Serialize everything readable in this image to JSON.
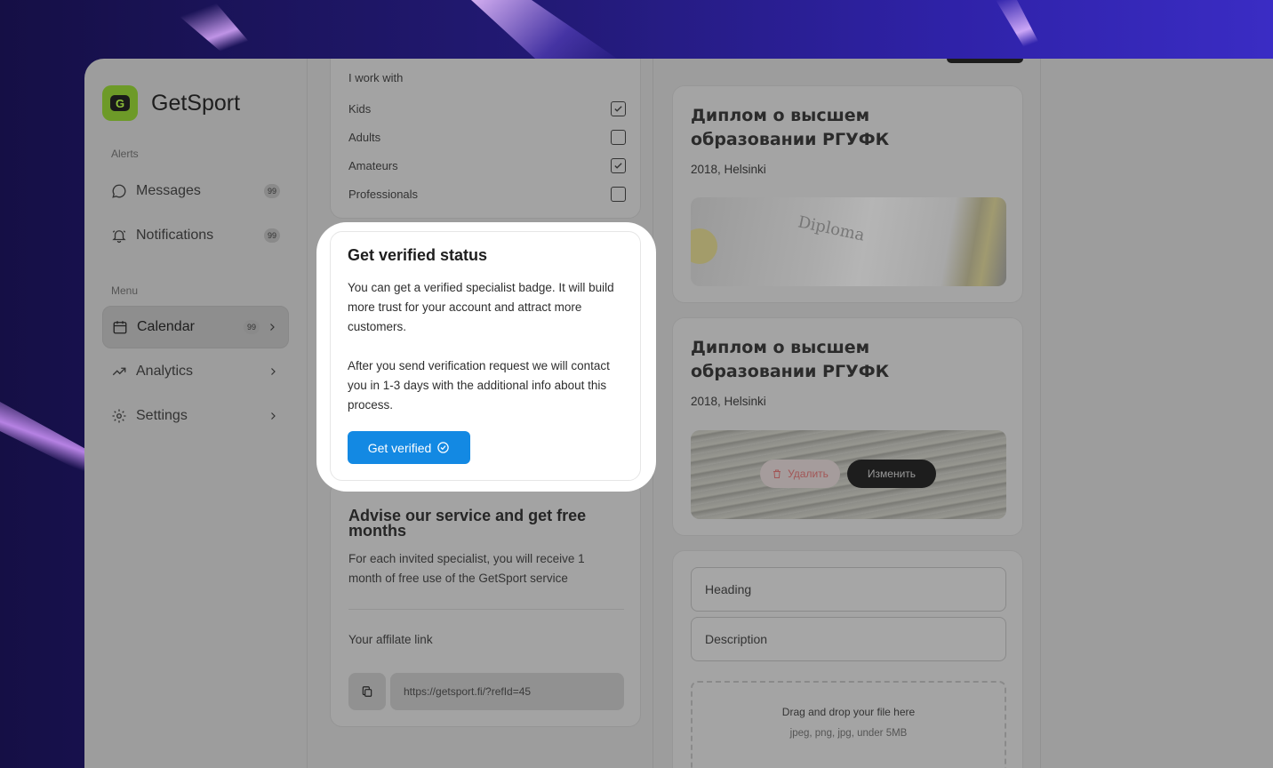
{
  "brand": {
    "name": "GetSport",
    "logo_letter": "G"
  },
  "sidebar": {
    "alerts_label": "Alerts",
    "menu_label": "Menu",
    "alerts": [
      {
        "label": "Messages",
        "badge": "99"
      },
      {
        "label": "Notifications",
        "badge": "99"
      }
    ],
    "menu": [
      {
        "label": "Calendar",
        "badge": "99",
        "active": true
      },
      {
        "label": "Analytics"
      },
      {
        "label": "Settings"
      }
    ]
  },
  "work_with": {
    "title": "I work with",
    "options": [
      {
        "label": "Kids",
        "checked": true
      },
      {
        "label": "Adults",
        "checked": false
      },
      {
        "label": "Amateurs",
        "checked": true
      },
      {
        "label": "Professionals",
        "checked": false
      }
    ]
  },
  "verified": {
    "title": "Get verified status",
    "text1": "You can get a verified specialist badge. It will build more trust for your account and attract more customers.",
    "text2": "After you send verification request we will contact you in 1-3 days with the additional info about this process.",
    "button": "Get verified"
  },
  "advise": {
    "title": "Advise our service and get free months",
    "text": "For each invited specialist, you will receive 1 month of free use of the GetSport service",
    "link_label": "Your affilate link",
    "link": "https://getsport.fi/?refId=45"
  },
  "diplomas": [
    {
      "title": "Диплом о высшем образовании РГУФК",
      "subtitle": "2018, Helsinki",
      "image_text": "Diploma"
    },
    {
      "title": "Диплом о высшем образовании РГУФК",
      "subtitle": "2018, Helsinki",
      "delete_label": "Удалить",
      "edit_label": "Изменить"
    }
  ],
  "form": {
    "heading_placeholder": "Heading",
    "description_placeholder": "Description",
    "drop_title": "Drag and drop your file here",
    "drop_sub": "jpeg, png, jpg, under 5MB"
  },
  "colors": {
    "accent": "#1389e3",
    "brand": "#6d9a28"
  }
}
